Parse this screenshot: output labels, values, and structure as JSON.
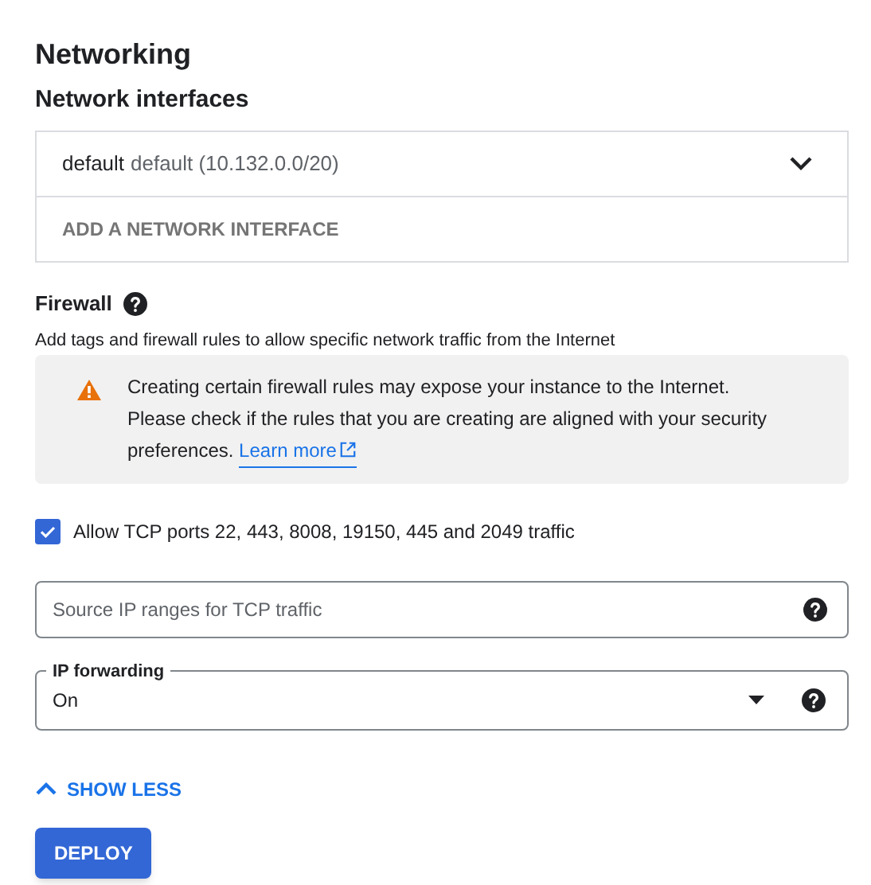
{
  "section_title": "Networking",
  "network_interfaces": {
    "title": "Network interfaces",
    "items": [
      {
        "name": "default",
        "detail": "default (10.132.0.0/20)",
        "expanded": false
      }
    ],
    "add_label": "ADD A NETWORK INTERFACE"
  },
  "firewall": {
    "title": "Firewall",
    "description": "Add tags and firewall rules to allow specific network traffic from the Internet",
    "warning": {
      "message": "Creating certain firewall rules may expose your instance to the Internet. Please check if the rules that you are creating are aligned with your security preferences.",
      "link": "Learn more"
    },
    "checkbox": {
      "label": "Allow TCP ports 22, 443, 8008, 19150, 445 and 2049 traffic",
      "checked": true
    },
    "source_ranges": {
      "placeholder": "Source IP ranges for TCP traffic"
    },
    "ip_forwarding": {
      "label": "IP forwarding",
      "value": "On"
    }
  },
  "show_less": "SHOW LESS",
  "deploy": "DEPLOY"
}
